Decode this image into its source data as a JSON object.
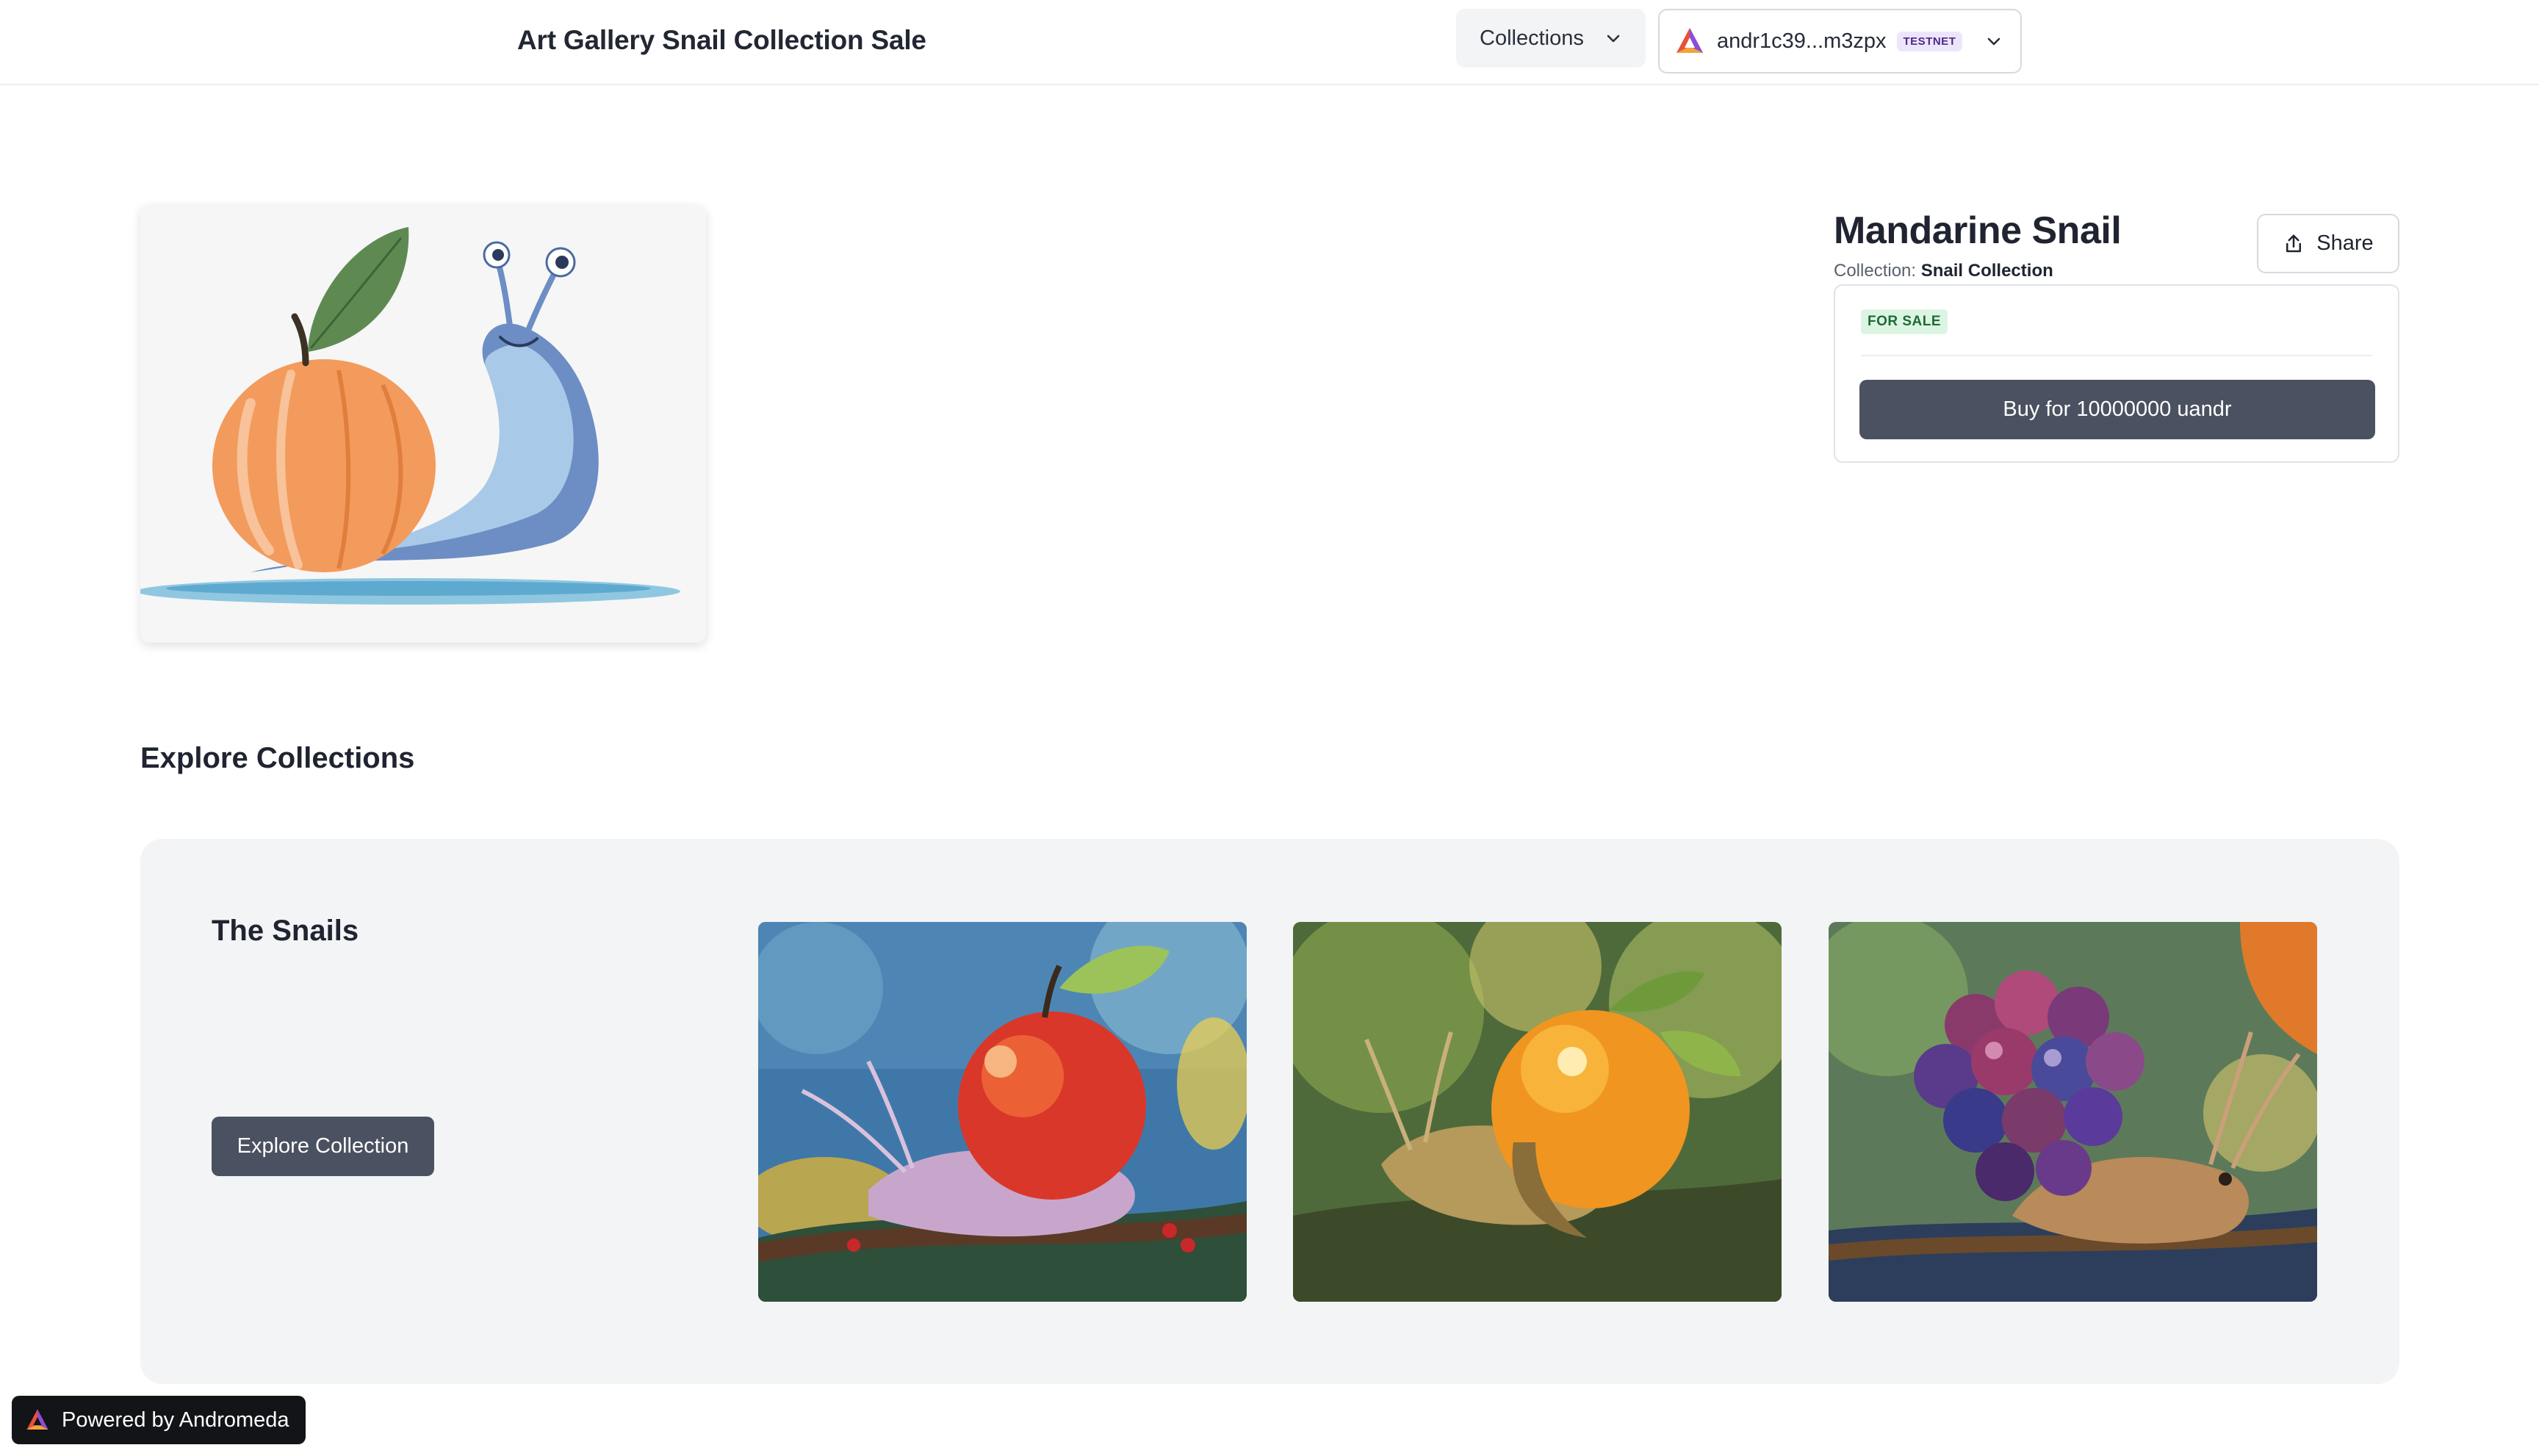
{
  "header": {
    "site_title": "Art Gallery Snail Collection Sale",
    "collections_label": "Collections",
    "wallet_address": "andr1c39...m3zpx",
    "network_badge": "TESTNET"
  },
  "nft": {
    "title": "Mandarine Snail",
    "collection_prefix": "Collection:",
    "collection_name": "Snail Collection",
    "share_label": "Share",
    "status_badge": "FOR SALE",
    "buy_label": "Buy for 10000000 uandr",
    "image_icon": "mandarine-snail-illustration"
  },
  "explore": {
    "heading": "Explore Collections",
    "collection_title": "The Snails",
    "explore_button_label": "Explore Collection",
    "thumbnails": [
      {
        "subject": "apple-snail-painting"
      },
      {
        "subject": "orange-snail-painting"
      },
      {
        "subject": "grape-snail-painting"
      }
    ]
  },
  "footer": {
    "powered_by": "Powered by Andromeda"
  },
  "colors": {
    "primary_button": "#4a5160",
    "panel_background": "#f3f4f6",
    "for_sale_bg": "#dcf5e3",
    "for_sale_text": "#1e6b37",
    "testnet_bg": "#ede6fb"
  }
}
